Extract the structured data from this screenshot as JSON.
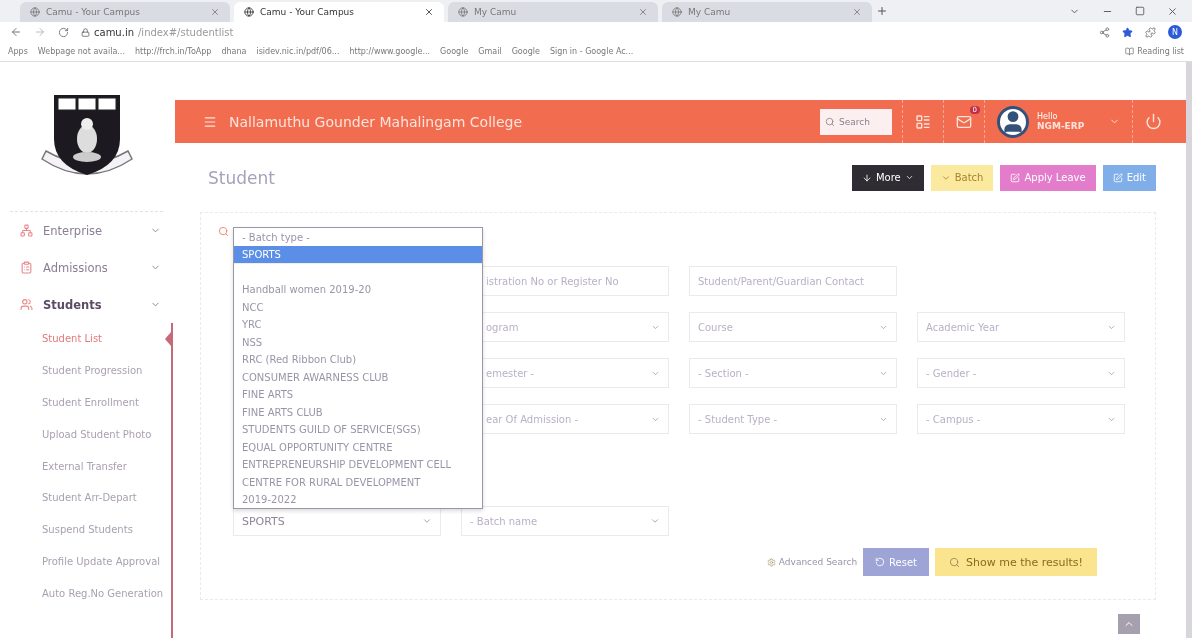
{
  "browser": {
    "tabs": [
      {
        "title": "Camu - Your Campus",
        "selected": false
      },
      {
        "title": "Camu - Your Campus",
        "selected": true
      },
      {
        "title": "My Camu",
        "selected": false
      },
      {
        "title": "My Camu",
        "selected": false
      }
    ],
    "address": {
      "host": "camu.in",
      "path": "/index#/studentlist"
    },
    "bookmarks": [
      "Apps",
      "Webpage not availa...",
      "http://frch.in/ToApp",
      "dhana",
      "isidev.nic.in/pdf/06...",
      "http://www.google...",
      "Google",
      "Gmail",
      "Google",
      "Sign in - Google Ac..."
    ],
    "reading_list": "Reading list",
    "profile_initial": "N"
  },
  "header": {
    "title": "Nallamuthu Gounder Mahalingam College",
    "search_placeholder": "Search",
    "mail_count": "0",
    "greeting": "Hello",
    "user": "NGM-ERP"
  },
  "sidebar": {
    "menu": [
      {
        "label": "Enterprise",
        "expanded": false
      },
      {
        "label": "Admissions",
        "expanded": false
      },
      {
        "label": "Students",
        "expanded": true,
        "children": [
          {
            "label": "Student List",
            "selected": true
          },
          {
            "label": "Student Progression",
            "selected": false
          },
          {
            "label": "Student Enrollment",
            "selected": false
          },
          {
            "label": "Upload Student Photo",
            "selected": false
          },
          {
            "label": "External Transfer",
            "selected": false
          },
          {
            "label": "Student Arr-Depart",
            "selected": false
          },
          {
            "label": "Suspend Students",
            "selected": false
          },
          {
            "label": "Profile Update Approval",
            "selected": false
          },
          {
            "label": "Auto Reg.No Generation",
            "selected": false
          }
        ]
      }
    ]
  },
  "page": {
    "title": "Student",
    "actions": [
      {
        "label": "More",
        "kind": "more"
      },
      {
        "label": "Batch",
        "kind": "batch"
      },
      {
        "label": "Apply Leave",
        "kind": "leave"
      },
      {
        "label": "Edit",
        "kind": "edit"
      }
    ]
  },
  "filters": {
    "rows": [
      [
        {
          "kind": "text",
          "placeholder": "istration No or Register No"
        },
        {
          "kind": "text",
          "placeholder": "Student/Parent/Guardian Contact"
        }
      ],
      [
        {
          "kind": "select",
          "placeholder": "ogram"
        },
        {
          "kind": "select",
          "placeholder": "Course"
        },
        {
          "kind": "select",
          "placeholder": "Academic Year"
        }
      ],
      [
        {
          "kind": "select",
          "placeholder": "emester -"
        },
        {
          "kind": "select",
          "placeholder": "- Section -"
        },
        {
          "kind": "select",
          "placeholder": "- Gender -"
        }
      ],
      [
        {
          "kind": "select",
          "placeholder": "ear Of Admission -"
        },
        {
          "kind": "select",
          "placeholder": "- Student Type -"
        },
        {
          "kind": "select",
          "placeholder": "- Campus -"
        }
      ]
    ],
    "batch_type": {
      "value": "SPORTS"
    },
    "batch_name": {
      "placeholder": "- Batch name"
    },
    "advanced_search": "Advanced Search",
    "reset": "Reset",
    "submit": "Show me the results!"
  },
  "batch_dropdown": {
    "options": [
      {
        "label": "- Batch type -",
        "selected": false,
        "separated": false
      },
      {
        "label": "SPORTS",
        "selected": true,
        "separated": false
      },
      {
        "label": "Handball women 2019-20",
        "selected": false,
        "separated": true
      },
      {
        "label": "NCC",
        "selected": false,
        "separated": false
      },
      {
        "label": "YRC",
        "selected": false,
        "separated": false
      },
      {
        "label": "NSS",
        "selected": false,
        "separated": false
      },
      {
        "label": "RRC (Red Ribbon Club)",
        "selected": false,
        "separated": false
      },
      {
        "label": "CONSUMER AWARNESS CLUB",
        "selected": false,
        "separated": false
      },
      {
        "label": "FINE ARTS",
        "selected": false,
        "separated": false
      },
      {
        "label": "FINE ARTS CLUB",
        "selected": false,
        "separated": false
      },
      {
        "label": "STUDENTS GUILD OF SERVICE(SGS)",
        "selected": false,
        "separated": false
      },
      {
        "label": "EQUAL OPPORTUNITY CENTRE",
        "selected": false,
        "separated": false
      },
      {
        "label": "ENTREPRENEURSHIP DEVELOPMENT CELL",
        "selected": false,
        "separated": false
      },
      {
        "label": "CENTRE FOR RURAL DEVELOPMENT",
        "selected": false,
        "separated": false
      },
      {
        "label": "2019-2022",
        "selected": false,
        "separated": false
      }
    ]
  }
}
